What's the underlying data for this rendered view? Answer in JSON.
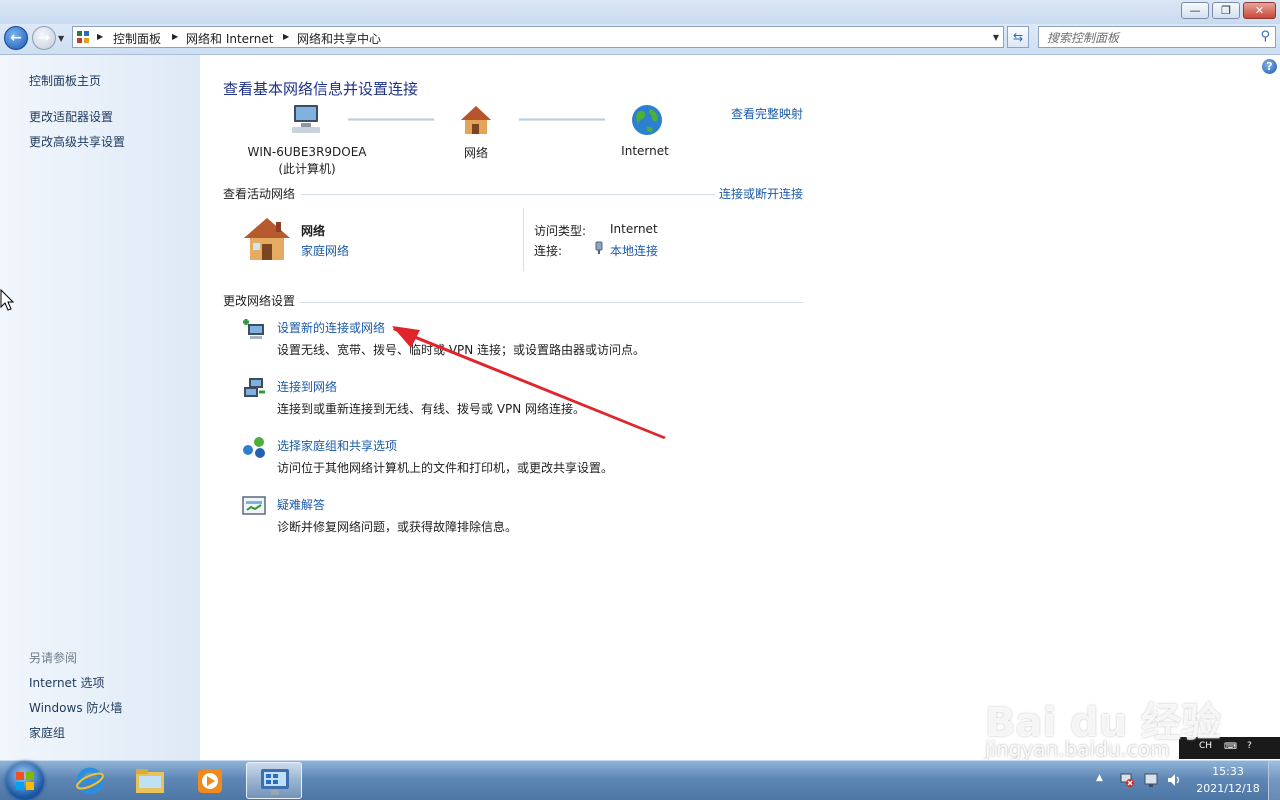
{
  "window": {
    "caption_buttons": {
      "minimize": "—",
      "maximize": "❐",
      "close": "✕"
    }
  },
  "address_bar": {
    "breadcrumbs": [
      "控制面板",
      "网络和 Internet",
      "网络和共享中心"
    ],
    "search_placeholder": "搜索控制面板"
  },
  "sidebar": {
    "home": "控制面板主页",
    "links": [
      "更改适配器设置",
      "更改高级共享设置"
    ],
    "see_also_heading": "另请参阅",
    "see_also": [
      "Internet 选项",
      "Windows 防火墙",
      "家庭组"
    ]
  },
  "main": {
    "title": "查看基本网络信息并设置连接",
    "full_map_link": "查看完整映射",
    "map": {
      "computer_name": "WIN-6UBE3R9DOEA",
      "computer_sub": "(此计算机)",
      "network": "网络",
      "internet": "Internet"
    },
    "active_networks": {
      "heading": "查看活动网络",
      "connect_link": "连接或断开连接",
      "network_name": "网络",
      "network_type": "家庭网络",
      "access_type_label": "访问类型:",
      "access_type_value": "Internet",
      "connections_label": "连接:",
      "connections_value": "本地连接"
    },
    "change_settings": {
      "heading": "更改网络设置",
      "tasks": [
        {
          "title": "设置新的连接或网络",
          "desc": "设置无线、宽带、拨号、临时或 VPN 连接；或设置路由器或访问点。",
          "icon": "new-connection-icon"
        },
        {
          "title": "连接到网络",
          "desc": "连接到或重新连接到无线、有线、拨号或 VPN 网络连接。",
          "icon": "connect-network-icon"
        },
        {
          "title": "选择家庭组和共享选项",
          "desc": "访问位于其他网络计算机上的文件和打印机，或更改共享设置。",
          "icon": "homegroup-icon"
        },
        {
          "title": "疑难解答",
          "desc": "诊断并修复网络问题，或获得故障排除信息。",
          "icon": "troubleshoot-icon"
        }
      ]
    }
  },
  "taskbar": {
    "time": "15:33",
    "date": "2021/12/18",
    "ime": "CH"
  },
  "watermark": {
    "brand": "Bai du 经验",
    "url": "jingyan.baidu.com"
  },
  "colors": {
    "link": "#1c5ba8",
    "title": "#1e3287",
    "sidebar_bg": "#dee9f6",
    "annotation_arrow": "#e0242a"
  }
}
